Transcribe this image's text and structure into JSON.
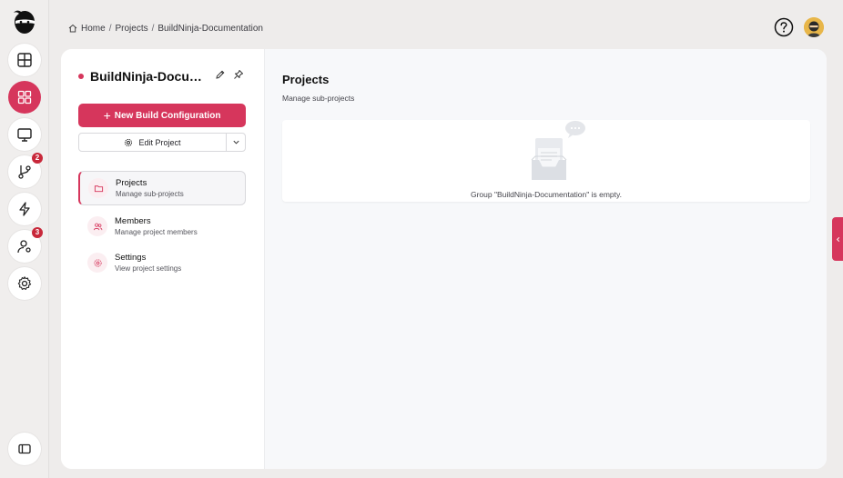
{
  "breadcrumb": {
    "items": [
      "Home",
      "Projects",
      "BuildNinja-Documentation"
    ],
    "separator": "/"
  },
  "rail": {
    "items": [
      {
        "name": "dashboard",
        "icon": "layout-icon",
        "badge": null
      },
      {
        "name": "projects",
        "icon": "grid-icon",
        "badge": null,
        "active": true
      },
      {
        "name": "agents",
        "icon": "monitor-icon",
        "badge": null
      },
      {
        "name": "vcs",
        "icon": "git-branch-icon",
        "badge": "2"
      },
      {
        "name": "builds",
        "icon": "lightning-icon",
        "badge": null
      },
      {
        "name": "users",
        "icon": "user-gear-icon",
        "badge": "3"
      },
      {
        "name": "settings",
        "icon": "gear-icon",
        "badge": null
      }
    ]
  },
  "project": {
    "title": "BuildNinja-Documentation",
    "new_build_label": "New Build Configuration",
    "edit_label": "Edit Project"
  },
  "nav": {
    "items": [
      {
        "title": "Projects",
        "subtitle": "Manage sub-projects"
      },
      {
        "title": "Members",
        "subtitle": "Manage project members"
      },
      {
        "title": "Settings",
        "subtitle": "View project settings"
      }
    ]
  },
  "main": {
    "title": "Projects",
    "subtitle": "Manage sub-projects",
    "empty_text": "Group \"BuildNinja-Documentation\" is empty."
  },
  "colors": {
    "accent": "#d6365c",
    "badge": "#c8283a",
    "background": "#eeeceb"
  }
}
